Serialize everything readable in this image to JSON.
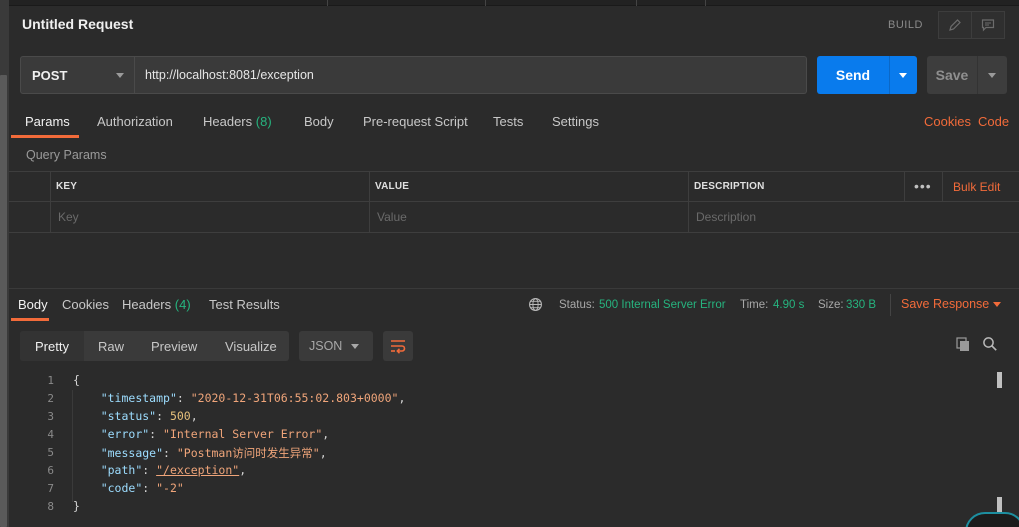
{
  "request": {
    "title": "Untitled Request",
    "build_label": "BUILD",
    "method": "POST",
    "url": "http://localhost:8081/exception",
    "send_label": "Send",
    "save_label": "Save"
  },
  "request_tabs": [
    {
      "label": "Params",
      "active": true
    },
    {
      "label": "Authorization"
    },
    {
      "label": "Headers",
      "count": "(8)"
    },
    {
      "label": "Body"
    },
    {
      "label": "Pre-request Script"
    },
    {
      "label": "Tests"
    },
    {
      "label": "Settings"
    }
  ],
  "links": {
    "cookies": "Cookies",
    "code": "Code"
  },
  "query_params": {
    "title": "Query Params",
    "columns": [
      "KEY",
      "VALUE",
      "DESCRIPTION"
    ],
    "placeholders": [
      "Key",
      "Value",
      "Description"
    ],
    "bulk_edit": "Bulk Edit",
    "more": "•••"
  },
  "response": {
    "tabs": [
      {
        "label": "Body",
        "active": true
      },
      {
        "label": "Cookies"
      },
      {
        "label": "Headers",
        "count": "(4)"
      },
      {
        "label": "Test Results"
      }
    ],
    "status_label": "Status:",
    "status_value": "500 Internal Server Error",
    "time_label": "Time:",
    "time_value": "4.90 s",
    "size_label": "Size:",
    "size_value": "330 B",
    "save_response": "Save Response",
    "view_modes": [
      "Pretty",
      "Raw",
      "Preview",
      "Visualize"
    ],
    "format": "JSON",
    "body_lines": [
      {
        "n": "1",
        "t": "{"
      },
      {
        "n": "2",
        "key": "\"timestamp\"",
        "val": "\"2020-12-31T06:55:02.803+0000\"",
        "comma": ","
      },
      {
        "n": "3",
        "key": "\"status\"",
        "num": "500",
        "comma": ","
      },
      {
        "n": "4",
        "key": "\"error\"",
        "val": "\"Internal Server Error\"",
        "comma": ","
      },
      {
        "n": "5",
        "key": "\"message\"",
        "val": "\"Postman访问时发生异常\"",
        "comma": ","
      },
      {
        "n": "6",
        "key": "\"path\"",
        "val": "\"/exception\"",
        "comma": ","
      },
      {
        "n": "7",
        "key": "\"code\"",
        "val": "\"-2\"",
        "comma": ""
      },
      {
        "n": "8",
        "t": "}"
      }
    ]
  },
  "colors": {
    "accent": "#f26b3a",
    "send": "#097bed",
    "success": "#26b47f"
  }
}
